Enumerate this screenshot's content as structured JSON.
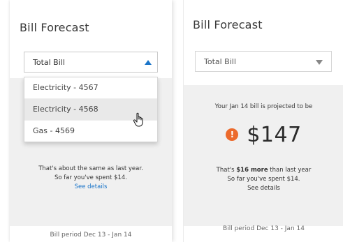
{
  "left": {
    "title": "Bill Forecast",
    "select_value": "Total Bill",
    "menu_items": [
      "Electricity - 4567",
      "Electricity - 4568",
      "Gas - 4569"
    ],
    "comparison": "That's about the same as last year.",
    "spent": "So far you've spent $14.",
    "details_link": "See details",
    "bill_period": "Bill period Dec 13 - Jan 14"
  },
  "right": {
    "title": "Bill Forecast",
    "select_value": "Total Bill",
    "projection": "Your Jan 14 bill is projected to be",
    "amount": "$147",
    "alert_symbol": "!",
    "comparison_prefix": "That's ",
    "comparison_bold": "$16 more",
    "comparison_suffix": " than last year",
    "spent": "So far you've spent $14.",
    "details_link": "See details",
    "bill_period": "Bill period Dec 13 - Jan 14"
  },
  "colors": {
    "accent": "#1b75c9",
    "alert": "#ec6a2c"
  }
}
